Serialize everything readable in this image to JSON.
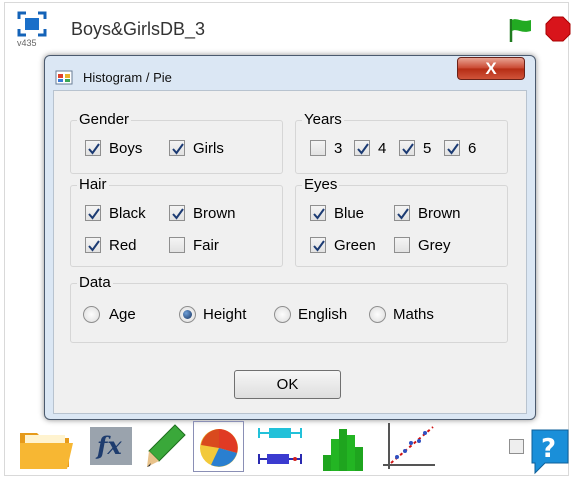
{
  "app": {
    "title": "Boys&GirlsDB_3",
    "version": "v435"
  },
  "dialog": {
    "title": "Histogram / Pie",
    "close_label": "X",
    "ok_label": "OK",
    "groups": {
      "gender": {
        "label": "Gender",
        "options": [
          {
            "label": "Boys",
            "checked": true
          },
          {
            "label": "Girls",
            "checked": true
          }
        ]
      },
      "years": {
        "label": "Years",
        "options": [
          {
            "label": "3",
            "checked": false
          },
          {
            "label": "4",
            "checked": true
          },
          {
            "label": "5",
            "checked": true
          },
          {
            "label": "6",
            "checked": true
          }
        ]
      },
      "hair": {
        "label": "Hair",
        "options": [
          {
            "label": "Black",
            "checked": true
          },
          {
            "label": "Brown",
            "checked": true
          },
          {
            "label": "Red",
            "checked": true
          },
          {
            "label": "Fair",
            "checked": false
          }
        ]
      },
      "eyes": {
        "label": "Eyes",
        "options": [
          {
            "label": "Blue",
            "checked": true
          },
          {
            "label": "Brown",
            "checked": true
          },
          {
            "label": "Green",
            "checked": true
          },
          {
            "label": "Grey",
            "checked": false
          }
        ]
      },
      "data": {
        "label": "Data",
        "selected": "Height",
        "options": [
          {
            "label": "Age"
          },
          {
            "label": "Height"
          },
          {
            "label": "English"
          },
          {
            "label": "Maths"
          }
        ]
      }
    }
  },
  "toolbar": {
    "icons": [
      "folder-icon",
      "fx-icon",
      "pencil-icon",
      "pie-chart-icon",
      "boxplot-icon",
      "histogram-icon",
      "scatter-plot-icon",
      "help-icon"
    ],
    "selected": "pie-chart-icon",
    "help_checkbox_checked": false
  },
  "colors": {
    "flag": "#22aa22",
    "stop": "#d8141b",
    "dialog_frame": "#dbe7f4",
    "close": "#c9452e",
    "accent": "#1a7fd6"
  }
}
